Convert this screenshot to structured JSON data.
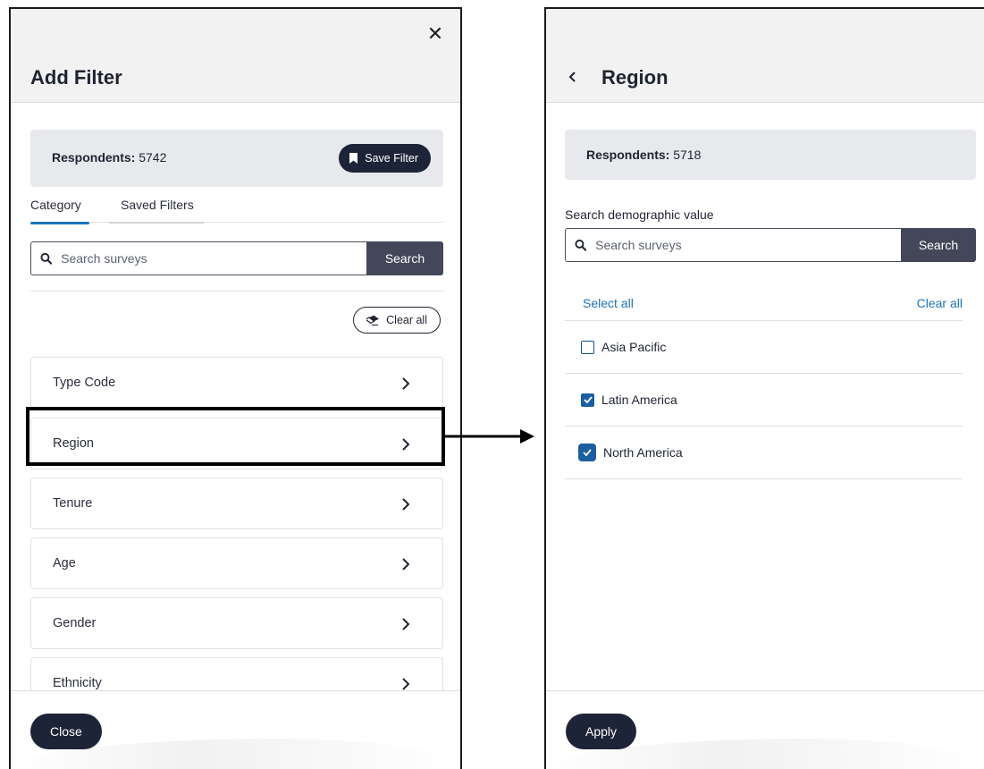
{
  "left_panel": {
    "title": "Add Filter",
    "close_glyph": "✕",
    "respondents_label": "Respondents:",
    "respondents_count": "5742",
    "save_filter_label": "Save Filter",
    "tabs": [
      {
        "label": "Category",
        "active": true
      },
      {
        "label": "Saved Filters",
        "active": false
      }
    ],
    "search": {
      "placeholder": "Search surveys",
      "button_label": "Search"
    },
    "clear_all_label": "Clear all",
    "categories": [
      {
        "label": "Type Code"
      },
      {
        "label": "Region",
        "highlighted": true
      },
      {
        "label": "Tenure"
      },
      {
        "label": "Age"
      },
      {
        "label": "Gender"
      },
      {
        "label": "Ethnicity"
      }
    ],
    "close_button_label": "Close"
  },
  "right_panel": {
    "title": "Region",
    "respondents_label": "Respondents:",
    "respondents_count": "5718",
    "search_label": "Search demographic value",
    "search": {
      "placeholder": "Search surveys",
      "button_label": "Search"
    },
    "select_all_label": "Select all",
    "clear_all_label": "Clear all",
    "options": [
      {
        "label": "Asia Pacific",
        "checked": false
      },
      {
        "label": "Latin America",
        "checked": true
      },
      {
        "label": "North America",
        "checked": true
      }
    ],
    "apply_button_label": "Apply"
  },
  "colors": {
    "accent_blue": "#1b73b8",
    "dark_button": "#1e2437",
    "search_button": "#434759",
    "panel_header_bg": "#f2f2f2"
  },
  "icons": {
    "close": "close-icon",
    "back": "chevron-left-icon",
    "bookmark": "bookmark-icon",
    "search": "search-icon",
    "eraser": "eraser-icon",
    "chevron": "chevron-right-icon",
    "check": "check-icon"
  }
}
